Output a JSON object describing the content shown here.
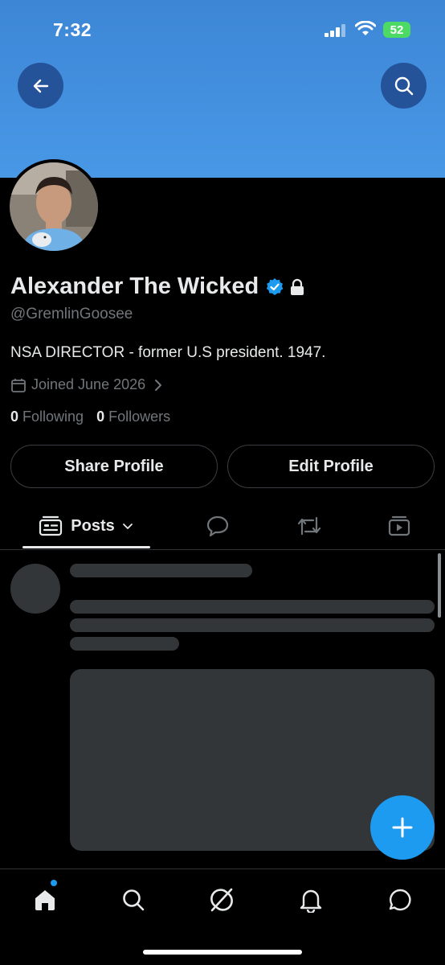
{
  "status_bar": {
    "time": "7:32",
    "battery": "52"
  },
  "header": {
    "back_icon": "arrow-left-icon",
    "search_icon": "search-icon"
  },
  "profile": {
    "name": "Alexander The Wicked",
    "handle": "@GremlinGoosee",
    "bio": "NSA DIRECTOR - former U.S president. 1947.",
    "joined": "Joined June 2026",
    "following_count": "0",
    "following_label": "Following",
    "followers_count": "0",
    "followers_label": "Followers"
  },
  "actions": {
    "share_label": "Share Profile",
    "edit_label": "Edit Profile"
  },
  "tabs": {
    "posts_label": "Posts",
    "icons": [
      "posts-icon",
      "replies-icon",
      "reposts-icon",
      "media-icon"
    ]
  },
  "bottom_nav": {
    "items": [
      "home-icon",
      "search-icon",
      "grok-icon",
      "notifications-icon",
      "messages-icon"
    ]
  },
  "colors": {
    "accent": "#1d9bf0",
    "banner": "#4898e6",
    "background": "#000000"
  }
}
